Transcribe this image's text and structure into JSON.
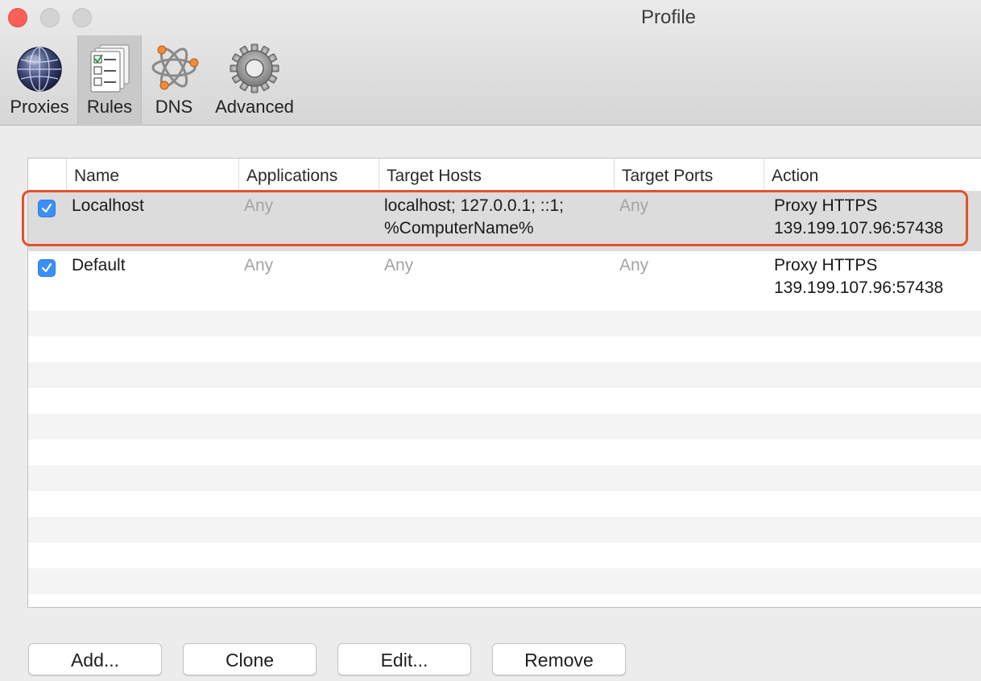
{
  "window": {
    "title": "Profile"
  },
  "toolbar": {
    "items": [
      {
        "label": "Proxies",
        "icon": "globe-icon"
      },
      {
        "label": "Rules",
        "icon": "rules-list-icon",
        "selected": true
      },
      {
        "label": "DNS",
        "icon": "dns-network-icon"
      },
      {
        "label": "Advanced",
        "icon": "gear-icon"
      }
    ]
  },
  "table": {
    "columns": [
      "Name",
      "Applications",
      "Target Hosts",
      "Target Ports",
      "Action"
    ],
    "rows": [
      {
        "enabled": true,
        "name": "Localhost",
        "applications": "Any",
        "target_hosts_line1": "localhost; 127.0.0.1; ::1;",
        "target_hosts_line2": "%ComputerName%",
        "target_ports": "Any",
        "action_line1": "Proxy HTTPS",
        "action_line2": "139.199.107.96:57438",
        "highlighted": true
      },
      {
        "enabled": true,
        "name": "Default",
        "applications": "Any",
        "target_hosts_line1": "Any",
        "target_hosts_line2": "",
        "target_ports": "Any",
        "action_line1": "Proxy HTTPS",
        "action_line2": "139.199.107.96:57438",
        "highlighted": false
      }
    ]
  },
  "buttons": {
    "add": "Add...",
    "clone": "Clone",
    "edit": "Edit...",
    "remove": "Remove"
  },
  "colors": {
    "highlight_border": "#e3512d",
    "checkbox": "#3a8ef7",
    "close_button": "#fc5f57"
  }
}
